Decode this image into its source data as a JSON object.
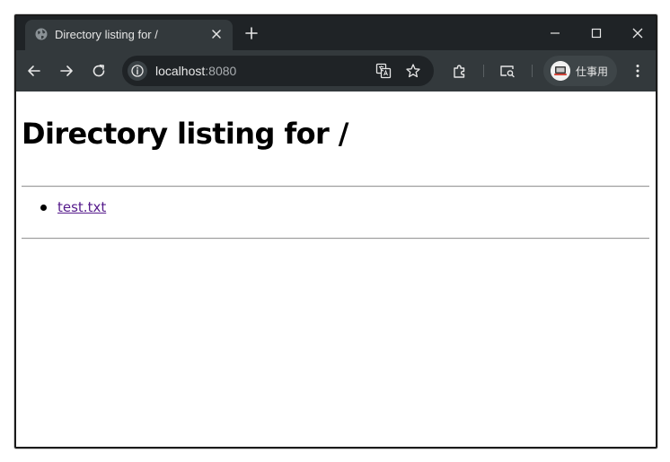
{
  "browser": {
    "tab": {
      "title": "Directory listing for /"
    },
    "address_bar": {
      "host": "localhost",
      "port": ":8080"
    },
    "profile": {
      "label": "仕事用"
    },
    "colors": {
      "frame": "#1f2326",
      "toolbar": "#33393c",
      "omnibox": "#1f2326",
      "visited_link": "#551a8b"
    }
  },
  "page": {
    "heading": "Directory listing for /",
    "files": [
      {
        "name": "test.txt"
      }
    ]
  }
}
